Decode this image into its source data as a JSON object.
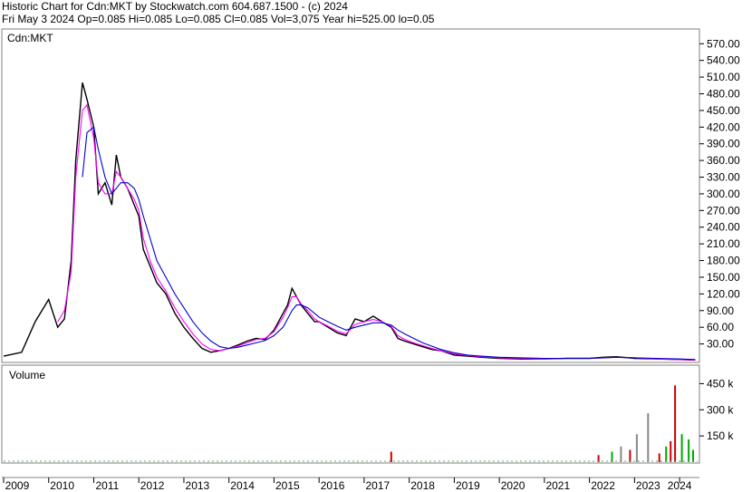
{
  "header": {
    "line1": "Historic Chart for Cdn:MKT by Stockwatch.com 604.687.1500 - (c) 2024",
    "line2": "Fri May  3 2024   Op=0.085   Hi=0.085   Lo=0.085   Cl=0.085   Vol=3,075   Year hi=525.00   lo=0.05"
  },
  "chart_data": {
    "type": "line",
    "price_panel": {
      "label": "Cdn:MKT",
      "ylim": [
        0,
        590
      ],
      "yticks": [
        "570.00",
        "540.00",
        "510.00",
        "480.00",
        "450.00",
        "420.00",
        "390.00",
        "360.00",
        "330.00",
        "300.00",
        "270.00",
        "240.00",
        "210.00",
        "180.00",
        "150.00",
        "120.00",
        "90.00",
        "60.00",
        "30.00"
      ],
      "ytick_values": [
        570,
        540,
        510,
        480,
        450,
        420,
        390,
        360,
        330,
        300,
        270,
        240,
        210,
        180,
        150,
        120,
        90,
        60,
        30
      ],
      "x": [
        2009.0,
        2009.4,
        2009.7,
        2010.0,
        2010.2,
        2010.35,
        2010.5,
        2010.6,
        2010.75,
        2010.85,
        2011.0,
        2011.1,
        2011.25,
        2011.4,
        2011.5,
        2011.6,
        2011.75,
        2011.9,
        2012.0,
        2012.1,
        2012.25,
        2012.4,
        2012.6,
        2012.8,
        2013.0,
        2013.2,
        2013.4,
        2013.6,
        2013.8,
        2014.0,
        2014.2,
        2014.4,
        2014.6,
        2014.8,
        2015.0,
        2015.2,
        2015.3,
        2015.4,
        2015.5,
        2015.6,
        2015.75,
        2015.9,
        2016.0,
        2016.2,
        2016.4,
        2016.6,
        2016.8,
        2017.0,
        2017.2,
        2017.4,
        2017.6,
        2017.75,
        2017.9,
        2018.1,
        2018.3,
        2018.5,
        2018.7,
        2019.0,
        2019.3,
        2019.6,
        2020.0,
        2020.5,
        2021.0,
        2021.5,
        2022.0,
        2022.3,
        2022.6,
        2023.0,
        2023.5,
        2024.0,
        2024.35
      ],
      "series": [
        {
          "name": "",
          "color": "#000000",
          "values": [
            8,
            15,
            70,
            110,
            60,
            75,
            180,
            360,
            500,
            470,
            420,
            300,
            320,
            280,
            370,
            330,
            310,
            280,
            260,
            200,
            170,
            140,
            120,
            85,
            60,
            40,
            22,
            15,
            18,
            22,
            28,
            35,
            40,
            38,
            55,
            85,
            100,
            130,
            115,
            100,
            85,
            70,
            70,
            60,
            50,
            45,
            75,
            70,
            80,
            70,
            60,
            40,
            35,
            30,
            25,
            20,
            18,
            10,
            8,
            6,
            4,
            3,
            3,
            4,
            4,
            6,
            7,
            4,
            3,
            2,
            1
          ]
        },
        {
          "name": "",
          "color": "#ff00ff",
          "values": [
            null,
            null,
            null,
            null,
            70,
            90,
            160,
            330,
            450,
            460,
            400,
            320,
            300,
            300,
            340,
            330,
            310,
            290,
            270,
            220,
            180,
            150,
            125,
            95,
            70,
            48,
            30,
            20,
            18,
            22,
            26,
            32,
            38,
            40,
            52,
            78,
            95,
            115,
            115,
            102,
            90,
            75,
            70,
            62,
            53,
            48,
            65,
            70,
            74,
            70,
            62,
            45,
            38,
            32,
            27,
            22,
            18,
            12,
            9,
            7,
            5,
            4,
            3,
            4,
            4,
            5,
            6,
            5,
            3,
            2,
            1
          ]
        },
        {
          "name": "",
          "color": "#0000cc",
          "values": [
            null,
            null,
            null,
            null,
            null,
            null,
            null,
            null,
            330,
            410,
            420,
            380,
            330,
            300,
            310,
            320,
            320,
            310,
            290,
            260,
            220,
            180,
            150,
            120,
            95,
            70,
            50,
            35,
            25,
            22,
            24,
            28,
            32,
            36,
            45,
            60,
            75,
            90,
            100,
            100,
            95,
            85,
            78,
            70,
            62,
            55,
            60,
            64,
            68,
            68,
            64,
            55,
            48,
            40,
            32,
            26,
            20,
            14,
            10,
            8,
            6,
            5,
            4,
            4,
            4,
            5,
            6,
            5,
            4,
            3,
            2
          ]
        }
      ]
    },
    "volume_panel": {
      "label": "Volume",
      "ylim": [
        0,
        530000
      ],
      "yticks": [
        "450 k",
        "300 k",
        "150 k"
      ],
      "ytick_values": [
        450000,
        300000,
        150000
      ],
      "bars": [
        {
          "x": 2017.6,
          "value": 60000,
          "color": "#cc0000"
        },
        {
          "x": 2022.2,
          "value": 40000,
          "color": "#cc0000"
        },
        {
          "x": 2022.5,
          "value": 60000,
          "color": "#00aa00"
        },
        {
          "x": 2022.7,
          "value": 90000,
          "color": "#888888"
        },
        {
          "x": 2022.9,
          "value": 70000,
          "color": "#cc0000"
        },
        {
          "x": 2023.05,
          "value": 160000,
          "color": "#888888"
        },
        {
          "x": 2023.3,
          "value": 280000,
          "color": "#888888"
        },
        {
          "x": 2023.55,
          "value": 50000,
          "color": "#cc0000"
        },
        {
          "x": 2023.7,
          "value": 90000,
          "color": "#00aa00"
        },
        {
          "x": 2023.8,
          "value": 120000,
          "color": "#cc0000"
        },
        {
          "x": 2023.9,
          "value": 440000,
          "color": "#cc0000"
        },
        {
          "x": 2024.05,
          "value": 160000,
          "color": "#00aa00"
        },
        {
          "x": 2024.2,
          "value": 130000,
          "color": "#00aa00"
        },
        {
          "x": 2024.3,
          "value": 70000,
          "color": "#00aa00"
        }
      ]
    },
    "x_axis": {
      "range": [
        2009.0,
        2024.4
      ],
      "tick_labels": [
        "2009",
        "2010",
        "2011",
        "2012",
        "2013",
        "2014",
        "2015",
        "2016",
        "2017",
        "2018",
        "2019",
        "2020",
        "2021",
        "2022",
        "2023",
        "2024"
      ],
      "tick_values": [
        2009.3,
        2010.3,
        2011.3,
        2012.3,
        2013.3,
        2014.3,
        2015.3,
        2016.3,
        2017.3,
        2018.3,
        2019.3,
        2020.3,
        2021.3,
        2022.3,
        2023.3,
        2024.0
      ]
    },
    "grid": false
  }
}
